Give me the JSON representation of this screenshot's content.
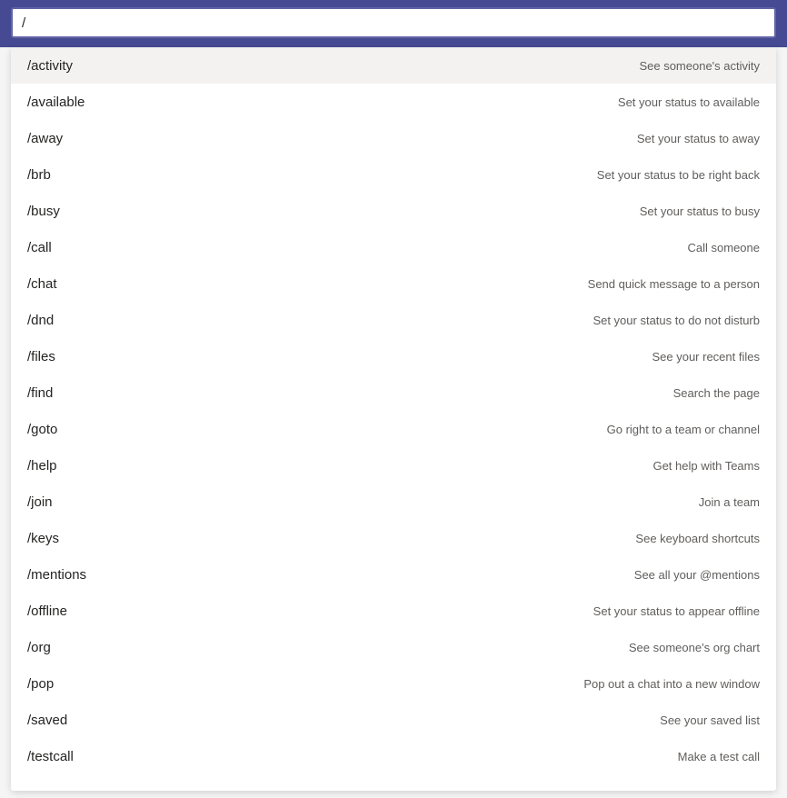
{
  "search": {
    "value": "/"
  },
  "commands": [
    {
      "name": "/activity",
      "desc": "See someone's activity",
      "highlighted": true
    },
    {
      "name": "/available",
      "desc": "Set your status to available",
      "highlighted": false
    },
    {
      "name": "/away",
      "desc": "Set your status to away",
      "highlighted": false
    },
    {
      "name": "/brb",
      "desc": "Set your status to be right back",
      "highlighted": false
    },
    {
      "name": "/busy",
      "desc": "Set your status to busy",
      "highlighted": false
    },
    {
      "name": "/call",
      "desc": "Call someone",
      "highlighted": false
    },
    {
      "name": "/chat",
      "desc": "Send quick message to a person",
      "highlighted": false
    },
    {
      "name": "/dnd",
      "desc": "Set your status to do not disturb",
      "highlighted": false
    },
    {
      "name": "/files",
      "desc": "See your recent files",
      "highlighted": false
    },
    {
      "name": "/find",
      "desc": "Search the page",
      "highlighted": false
    },
    {
      "name": "/goto",
      "desc": "Go right to a team or channel",
      "highlighted": false
    },
    {
      "name": "/help",
      "desc": "Get help with Teams",
      "highlighted": false
    },
    {
      "name": "/join",
      "desc": "Join a team",
      "highlighted": false
    },
    {
      "name": "/keys",
      "desc": "See keyboard shortcuts",
      "highlighted": false
    },
    {
      "name": "/mentions",
      "desc": "See all your @mentions",
      "highlighted": false
    },
    {
      "name": "/offline",
      "desc": "Set your status to appear offline",
      "highlighted": false
    },
    {
      "name": "/org",
      "desc": "See someone's org chart",
      "highlighted": false
    },
    {
      "name": "/pop",
      "desc": "Pop out a chat into a new window",
      "highlighted": false
    },
    {
      "name": "/saved",
      "desc": "See your saved list",
      "highlighted": false
    },
    {
      "name": "/testcall",
      "desc": "Make a test call",
      "highlighted": false
    }
  ]
}
